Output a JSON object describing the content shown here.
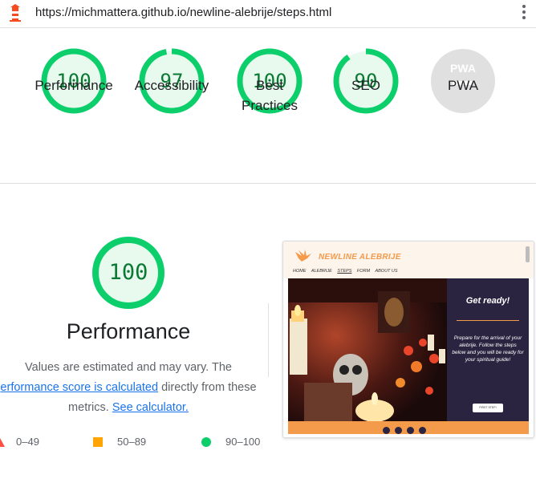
{
  "url_bar": {
    "url": "https://michmattera.github.io/newline-alebrije/steps.html"
  },
  "scores": [
    {
      "label": "Performance",
      "value": "100",
      "fraction": 1.0
    },
    {
      "label": "Accessibility",
      "value": "97",
      "fraction": 0.97
    },
    {
      "label": "Best Practices",
      "value": "100",
      "fraction": 1.0
    },
    {
      "label": "SEO",
      "value": "90",
      "fraction": 0.9
    },
    {
      "label": "PWA",
      "value": "PWA",
      "fraction": 0
    }
  ],
  "performance": {
    "score": "100",
    "title": "Performance",
    "desc_line1": "Values are estimated and may vary. The",
    "desc_link1": "erformance score is calculated",
    "desc_after_link1": " directly from these",
    "desc_line3_prefix": "metrics. ",
    "desc_link2": "See calculator.",
    "legend": [
      {
        "range": "0–49"
      },
      {
        "range": "50–89"
      },
      {
        "range": "90–100"
      }
    ]
  },
  "thumbnail": {
    "brand": "NEWLINE ALEBRIJE",
    "nav": [
      "HOME",
      "ALEBRIJE",
      "STEPS",
      "FORM",
      "ABOUT US"
    ],
    "heading": "Get ready!",
    "text": "Prepare for the arrival of your alebrije. Follow the steps below and you will be ready for your spiritual guide!",
    "button": "FIRST STEP!"
  },
  "colors": {
    "pass_green": "#0cce6b",
    "pass_text": "#0a7a33",
    "average_orange": "#ffa400",
    "fail_red": "#ff4e42",
    "pwa_gray": "#e0e0e0",
    "accent": "#f39a4b"
  }
}
